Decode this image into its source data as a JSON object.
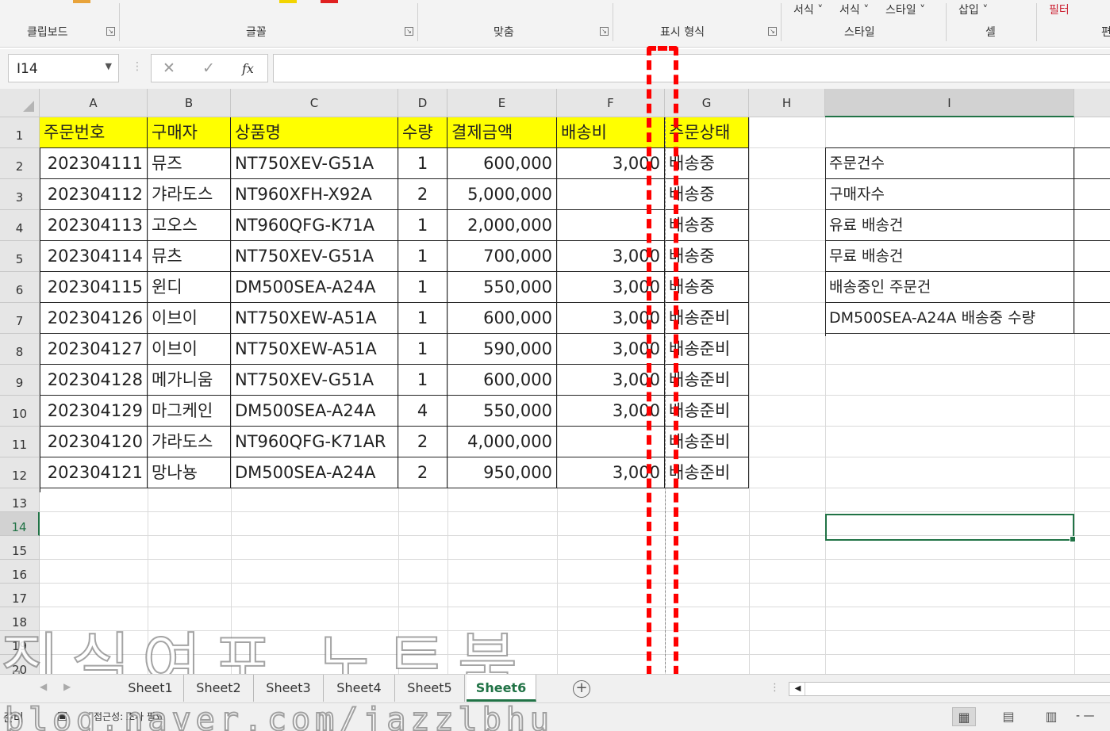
{
  "ribbon": {
    "groups": [
      "클립보드",
      "글꼴",
      "맞춤",
      "표시 형식",
      "스타일",
      "셀",
      "편"
    ],
    "top_items": [
      "서식 ˅",
      "서식 ˅",
      "스타일 ˅",
      "삽입 ˅",
      "필터"
    ],
    "launcher_glyph": "↘"
  },
  "formula_bar": {
    "name_box": "I14",
    "dropdown_glyph": "▼",
    "dots": "⋮",
    "cancel_glyph": "✕",
    "enter_glyph": "✓",
    "fx_label": "fx",
    "value": ""
  },
  "grid": {
    "columns": [
      "A",
      "B",
      "C",
      "D",
      "E",
      "F",
      "G",
      "H",
      "I"
    ],
    "rows": [
      "1",
      "2",
      "3",
      "4",
      "5",
      "6",
      "7",
      "8",
      "9",
      "10",
      "11",
      "12",
      "13",
      "14",
      "15",
      "16",
      "17",
      "18",
      "19",
      "20"
    ],
    "selected_cell": "I14",
    "headers": [
      "주문번호",
      "구매자",
      "상품명",
      "수량",
      "결제금액",
      "배송비",
      "주문상태"
    ],
    "records": [
      {
        "order": "202304111",
        "buyer": "뮤즈",
        "product": "NT750XEV-G51A",
        "qty": "1",
        "amount": "600,000",
        "shipping": "3,000",
        "status": "배송중"
      },
      {
        "order": "202304112",
        "buyer": "갸라도스",
        "product": "NT960XFH-X92A",
        "qty": "2",
        "amount": "5,000,000",
        "shipping": "",
        "status": "배송중"
      },
      {
        "order": "202304113",
        "buyer": "고오스",
        "product": "NT960QFG-K71A",
        "qty": "1",
        "amount": "2,000,000",
        "shipping": "",
        "status": "배송중"
      },
      {
        "order": "202304114",
        "buyer": "뮤츠",
        "product": "NT750XEV-G51A",
        "qty": "1",
        "amount": "700,000",
        "shipping": "3,000",
        "status": "배송중"
      },
      {
        "order": "202304115",
        "buyer": "윈디",
        "product": "DM500SEA-A24A",
        "qty": "1",
        "amount": "550,000",
        "shipping": "3,000",
        "status": "배송중"
      },
      {
        "order": "202304126",
        "buyer": "이브이",
        "product": "NT750XEW-A51A",
        "qty": "1",
        "amount": "600,000",
        "shipping": "3,000",
        "status": "배송준비"
      },
      {
        "order": "202304127",
        "buyer": "이브이",
        "product": "NT750XEW-A51A",
        "qty": "1",
        "amount": "590,000",
        "shipping": "3,000",
        "status": "배송준비"
      },
      {
        "order": "202304128",
        "buyer": "메가니움",
        "product": "NT750XEV-G51A",
        "qty": "1",
        "amount": "600,000",
        "shipping": "3,000",
        "status": "배송준비"
      },
      {
        "order": "202304129",
        "buyer": "마그케인",
        "product": "DM500SEA-A24A",
        "qty": "4",
        "amount": "550,000",
        "shipping": "3,000",
        "status": "배송준비"
      },
      {
        "order": "202304120",
        "buyer": "갸라도스",
        "product": "NT960QFG-K71AR",
        "qty": "2",
        "amount": "4,000,000",
        "shipping": "",
        "status": "배송준비"
      },
      {
        "order": "202304121",
        "buyer": "망나뇽",
        "product": "DM500SEA-A24A",
        "qty": "2",
        "amount": "950,000",
        "shipping": "3,000",
        "status": "배송준비"
      }
    ],
    "summary_labels": [
      "주문건수",
      "구매자수",
      "유료 배송건",
      "무료 배송건",
      "배송중인 주문건",
      "DM500SEA-A24A 배송중 수량"
    ]
  },
  "sheets": {
    "tabs": [
      "Sheet1",
      "Sheet2",
      "Sheet3",
      "Sheet4",
      "Sheet5",
      "Sheet6"
    ],
    "active": "Sheet6",
    "add_glyph": "+",
    "nav_prev": "◀",
    "nav_next": "▶"
  },
  "status_bar": {
    "ready": "준비",
    "accessibility": "접근성: 조사 필요",
    "view_normal": "▦",
    "view_layout": "▤",
    "view_pagebreak": "▥",
    "zoom_dash": "- —"
  },
  "watermark": {
    "line1": "진실여포 노트북",
    "line2": "blog.naver.com/jazzlbhu"
  },
  "colors": {
    "header_fill": "#ffff00",
    "accent": "#217346",
    "annotation": "#ff0000"
  }
}
